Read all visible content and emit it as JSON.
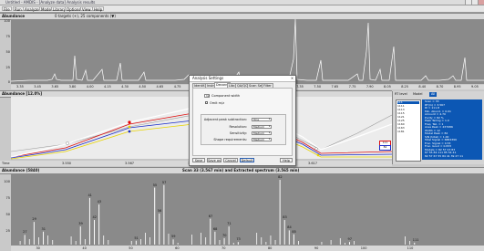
{
  "window": {
    "title": "Untitled - AMDIS - [Analyze data] Analysis results"
  },
  "toolbar": {
    "buttons": [
      {
        "label": "File"
      },
      {
        "label": "Run"
      },
      {
        "label": "Analyze"
      },
      {
        "label": "Mode"
      },
      {
        "label": "Library"
      },
      {
        "label": "Options"
      },
      {
        "label": "View"
      },
      {
        "label": "Help"
      }
    ]
  },
  "chromatogram": {
    "header": "Abundance",
    "targets_text": "0 targets (+), 25 components (▼)",
    "y_ticks": [
      "100",
      "75",
      "50",
      "25",
      "0"
    ],
    "x_ticks": [
      "3.35",
      "3.45",
      "3.65",
      "3.80",
      "4.00",
      "4.15",
      "4.30",
      "4.50",
      "4.65",
      "4.75",
      "4.90",
      "5.10",
      "5.25",
      "5.40",
      "6.97",
      "7.15",
      "7.35",
      "7.50",
      "7.65",
      "7.75",
      "7.90",
      "8.05",
      "8.25",
      "8.40",
      "8.70",
      "8.95",
      "9.05"
    ]
  },
  "profile": {
    "header": "Abundance [12.0%]",
    "x_ticks": [
      "3.550",
      "3.567",
      "3.585",
      "3.617"
    ],
    "axis_label": "Time",
    "mini_labels": [
      "111",
      "82"
    ]
  },
  "spectrum": {
    "header": "Abundance (5840)",
    "scan_text": "Scan 33 (3.567 min) and Extracted spectrum (3.565 min)",
    "y_ticks": [
      "100",
      "75",
      "50",
      "25"
    ],
    "x_ticks": [
      "30",
      "40",
      "50",
      "60",
      "70",
      "80",
      "90",
      "100",
      "110"
    ],
    "peak_labels": [
      "27",
      "29",
      "31",
      "39",
      "41",
      "42",
      "43",
      "51",
      "55",
      "56",
      "57",
      "59",
      "67",
      "68",
      "70",
      "71",
      "73",
      "82",
      "83",
      "84",
      "85",
      "97",
      "111"
    ]
  },
  "dialog": {
    "title": "Analysis Settings",
    "close": "×",
    "tabs": [
      {
        "label": "Identif."
      },
      {
        "label": "Instr."
      },
      {
        "label": "Deconv."
      },
      {
        "label": "Libr."
      },
      {
        "label": "QA/QC"
      },
      {
        "label": "Scan Sets"
      },
      {
        "label": "Filter"
      }
    ],
    "component_width_label": "Component width",
    "component_width_value": "12",
    "omit_mz_label": "Omit m/z",
    "rows": [
      {
        "label": "Adjacent peak subtraction:",
        "value": "One"
      },
      {
        "label": "Resolution:",
        "value": "Medium"
      },
      {
        "label": "Sensitivity:",
        "value": "Medium"
      },
      {
        "label": "Shape requirements:",
        "value": "Medium"
      }
    ],
    "buttons": [
      {
        "label": "Save"
      },
      {
        "label": "Save as"
      },
      {
        "label": "Cancel"
      },
      {
        "label": "Default"
      },
      {
        "label": "Help"
      }
    ]
  },
  "info_panel": {
    "tabs": [
      {
        "label": "RT level"
      },
      {
        "label": "Model"
      },
      {
        "label": "All"
      }
    ],
    "components": [
      "111",
      "1111",
      "1113",
      "1115",
      "1121",
      "1125",
      "1160",
      "1163",
      "1181"
    ],
    "details": [
      "Scan = 33",
      "RT(m) = 3.567",
      "RI = 111.8",
      "Min. Abund. = 0.01",
      "Amount = 4.70",
      "Purity = 82 %",
      "Peak Tailing = 1.0",
      "Freq. Tail. = 1",
      "Area Peak = 437086",
      "Width = 12",
      "Model Peak = 82",
      "S/N (total) = 1.00",
      "Total Signal = 6884399",
      "Frac. Signal = 0.53",
      "Frac. Good = 0.833",
      "Models = 82 57 43 83",
      "67 55 84 111 85 54 41",
      "82 57 67 55 84 41 39 27 11"
    ]
  },
  "colors": {
    "plot_bg": "#8a8a8a",
    "trace": "#ffffff",
    "dialog_bg": "#efefef",
    "detail_bg": "#0c57b4",
    "line_red": "#d11",
    "line_blue": "#1a2cc8",
    "line_yellow": "#e8d400",
    "marker_red": "#e60000"
  }
}
